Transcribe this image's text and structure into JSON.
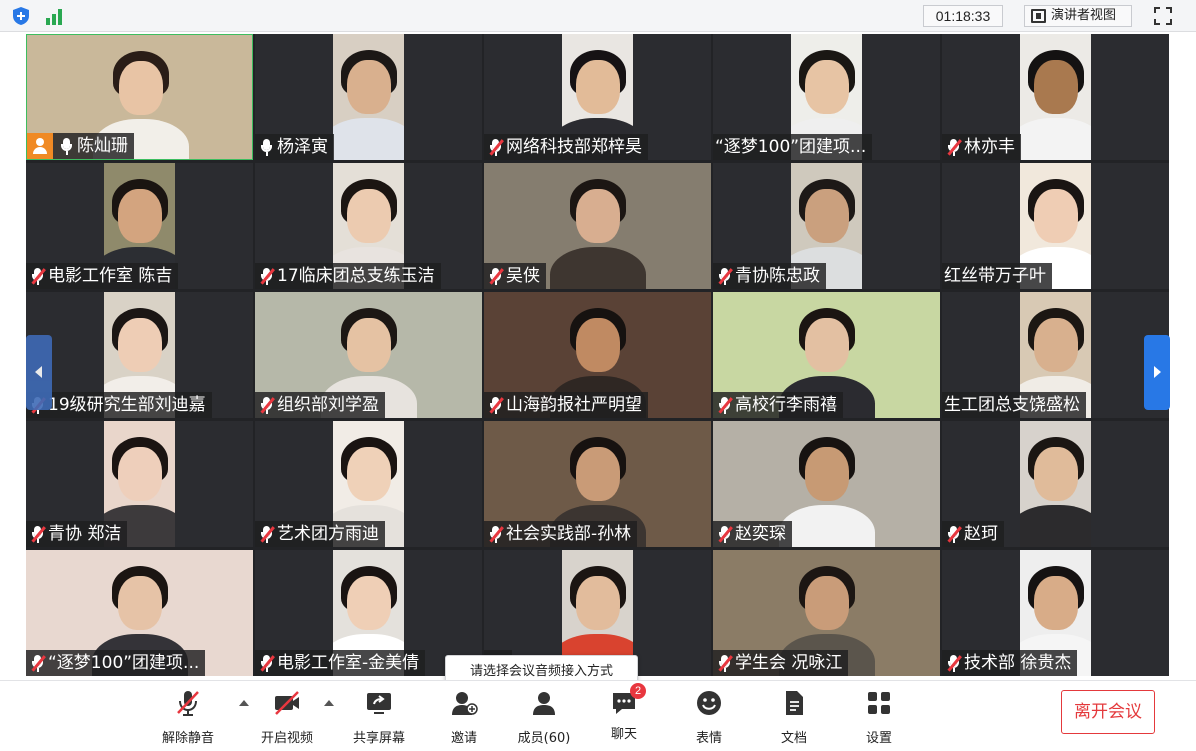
{
  "topbar": {
    "timer": "01:18:33",
    "presenter_view_label": "演讲者视图",
    "icons": [
      "shield-icon",
      "signal-icon",
      "fullscreen-icon"
    ]
  },
  "participants": [
    {
      "name": "陈灿珊",
      "mic": "on",
      "avatar": true,
      "active": true
    },
    {
      "name": "杨泽寅",
      "mic": "on"
    },
    {
      "name": "网络科技部郑梓昊",
      "mic": "muted"
    },
    {
      "name": "“逐梦100”团建项...",
      "mic": "none"
    },
    {
      "name": "林亦丰",
      "mic": "muted"
    },
    {
      "name": "电影工作室 陈吉",
      "mic": "muted"
    },
    {
      "name": "17临床团总支练玉洁",
      "mic": "muted"
    },
    {
      "name": "吴侠",
      "mic": "muted"
    },
    {
      "name": "青协陈忠政",
      "mic": "muted"
    },
    {
      "name": "红丝带万子叶",
      "mic": "none"
    },
    {
      "name": "19级研究生部刘迪嘉",
      "mic": "muted"
    },
    {
      "name": "组织部刘学盈",
      "mic": "muted"
    },
    {
      "name": "山海韵报社严明望",
      "mic": "muted"
    },
    {
      "name": "高校行李雨禧",
      "mic": "muted"
    },
    {
      "name": "生工团总支饶盛松",
      "mic": "none"
    },
    {
      "name": "青协 郑洁",
      "mic": "muted"
    },
    {
      "name": "艺术团方雨迪",
      "mic": "muted"
    },
    {
      "name": "社会实践部-孙林",
      "mic": "muted"
    },
    {
      "name": "赵奕琛",
      "mic": "muted"
    },
    {
      "name": "赵珂",
      "mic": "muted"
    },
    {
      "name": "“逐梦100”团建项...",
      "mic": "muted"
    },
    {
      "name": "电影工作室-金美倩",
      "mic": "muted"
    },
    {
      "name": "",
      "mic": "muted"
    },
    {
      "name": "学生会 况咏江",
      "mic": "muted"
    },
    {
      "name": "技术部 徐贵杰",
      "mic": "muted"
    }
  ],
  "nav": {
    "prev_icon": "chevron-left-icon",
    "next_icon": "chevron-right-icon"
  },
  "toolbar": {
    "unmute": "解除静音",
    "start_video": "开启视频",
    "share_screen": "共享屏幕",
    "invite": "邀请",
    "members": "成员(60)",
    "chat": "聊天",
    "chat_badge": "2",
    "reactions": "表情",
    "docs": "文档",
    "settings": "设置",
    "leave": "离开会议"
  },
  "tooltip": "请选择会议音频接入方式",
  "colors": {
    "accent": "#2878e6",
    "danger": "#e4393c",
    "mute_red": "#e8373f",
    "active_border": "#3dbd5f"
  }
}
